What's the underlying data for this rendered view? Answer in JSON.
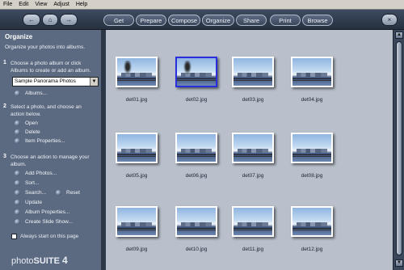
{
  "menu": {
    "items": [
      "File",
      "Edit",
      "View",
      "Adjust",
      "Help"
    ]
  },
  "toolbar": {
    "back_label": "←",
    "home_label": "⌂",
    "forward_label": "→",
    "buttons": [
      "Get",
      "Prepare",
      "Compose",
      "Organize",
      "Share",
      "Print",
      "Browse"
    ],
    "close_label": "×"
  },
  "sidebar": {
    "title": "Organize",
    "intro": "Organize your photos into albums.",
    "step1_num": "1",
    "step1_text_a": "Choose a photo album or click",
    "step1_text_b": "Albums to create or add an album.",
    "album_select": "Sample Panorama Photos",
    "albums_link": "Albums...",
    "step2_num": "2",
    "step2_text_a": "Select a photo, and choose an",
    "step2_text_b": "action below.",
    "step2_actions": [
      "Open",
      "Delete",
      "Item Properties..."
    ],
    "step3_num": "3",
    "step3_text_a": "Choose an action to manage your",
    "step3_text_b": "album.",
    "step3_actions": [
      "Add Photos...",
      "Sort...",
      "Search...",
      "Update",
      "Album Properties...",
      "Create Slide Show..."
    ],
    "reset_label": "Reset",
    "always_start": "Always start on this page",
    "logo_photo": "photo",
    "logo_suite": "SUITE",
    "logo_version": "4"
  },
  "gallery": {
    "photos": [
      {
        "caption": "det01.jpg"
      },
      {
        "caption": "det02.jpg"
      },
      {
        "caption": "det03.jpg"
      },
      {
        "caption": "det04.jpg"
      },
      {
        "caption": "det05.jpg"
      },
      {
        "caption": "det06.jpg"
      },
      {
        "caption": "det07.jpg"
      },
      {
        "caption": "det08.jpg"
      },
      {
        "caption": "det09.jpg"
      },
      {
        "caption": "det10.jpg"
      },
      {
        "caption": "det11.jpg"
      },
      {
        "caption": "det12.jpg"
      }
    ],
    "selected_index": 1
  },
  "scrollbar": {
    "up_label": "▲",
    "down_label": "▼"
  }
}
